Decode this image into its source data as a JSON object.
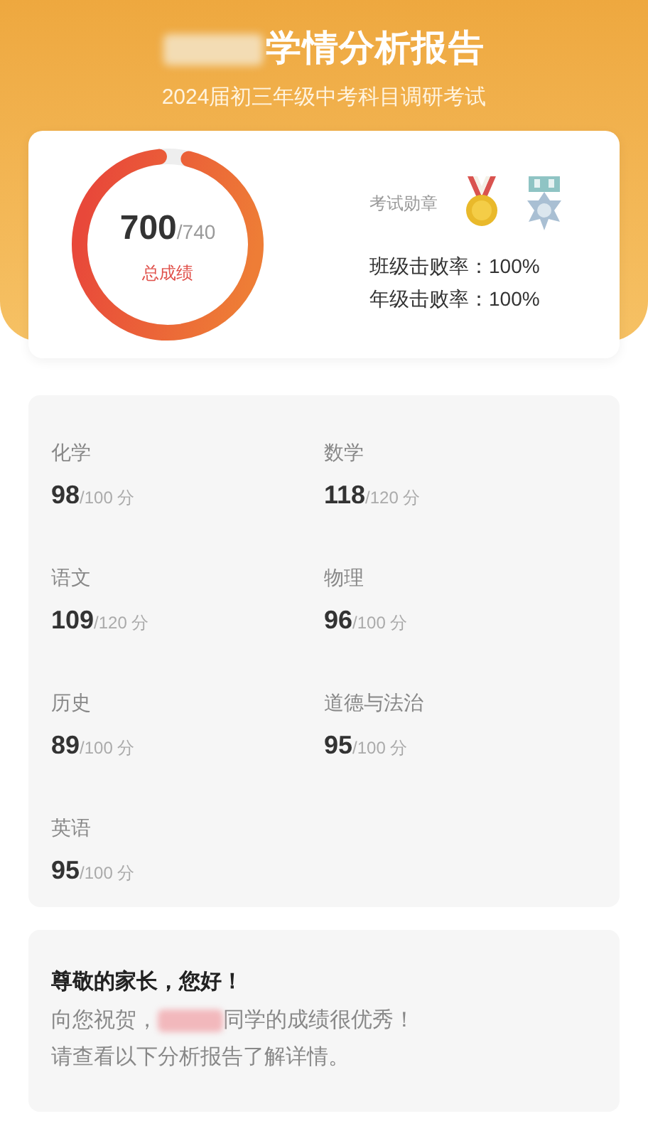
{
  "header": {
    "title": "学情分析报告",
    "subtitle": "2024届初三年级中考科目调研考试"
  },
  "summary": {
    "score": "700",
    "total": "/740",
    "label": "总成绩",
    "level": 0.946,
    "medals_label": "考试勋章",
    "medals": [
      {
        "kind": "gold"
      },
      {
        "kind": "silver"
      }
    ],
    "rates": [
      {
        "label": "班级击败率：",
        "value": "100%"
      },
      {
        "label": "年级击败率：",
        "value": "100%"
      }
    ]
  },
  "subjects": [
    {
      "name": "化学",
      "score": "98",
      "total": "/100 分"
    },
    {
      "name": "数学",
      "score": "118",
      "total": "/120 分"
    },
    {
      "name": "语文",
      "score": "109",
      "total": "/120 分"
    },
    {
      "name": "物理",
      "score": "96",
      "total": "/100 分"
    },
    {
      "name": "历史",
      "score": "89",
      "total": "/100 分"
    },
    {
      "name": "道德与法治",
      "score": "95",
      "total": "/100 分"
    },
    {
      "name": "英语",
      "score": "95",
      "total": "/100 分"
    }
  ],
  "greeting": {
    "heading": "尊敬的家长，您好！",
    "line_start": "向您祝贺，",
    "line_end": "同学的成绩很优秀！",
    "line_2": "请查看以下分析报告了解详情。"
  }
}
